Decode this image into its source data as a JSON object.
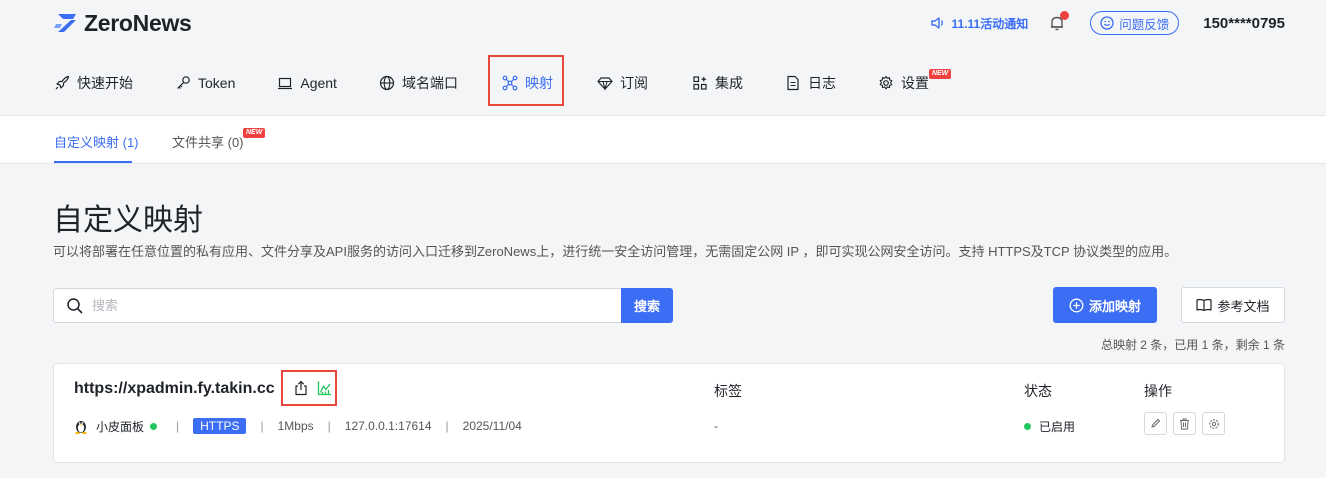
{
  "app": {
    "logo_text": "ZeroNews",
    "notice": "11.11活动通知",
    "feedback": "问题反馈",
    "user": "150****0795"
  },
  "nav": {
    "items": [
      {
        "label": "快速开始",
        "icon": "rocket-icon"
      },
      {
        "label": "Token",
        "icon": "key-icon"
      },
      {
        "label": "Agent",
        "icon": "laptop-icon"
      },
      {
        "label": "域名端口",
        "icon": "globe-icon"
      },
      {
        "label": "映射",
        "icon": "mapping-icon",
        "active": true
      },
      {
        "label": "订阅",
        "icon": "diamond-icon"
      },
      {
        "label": "集成",
        "icon": "grid-icon"
      },
      {
        "label": "日志",
        "icon": "file-icon"
      },
      {
        "label": "设置",
        "icon": "gear-icon",
        "badge": "NEW"
      }
    ]
  },
  "subtabs": [
    {
      "label": "自定义映射 (1)",
      "active": true
    },
    {
      "label": "文件共享 (0)",
      "badge": "NEW"
    }
  ],
  "page": {
    "title": "自定义映射",
    "description": "可以将部署在任意位置的私有应用、文件分享及API服务的访问入口迁移到ZeroNews上，进行统一安全访问管理，无需固定公网 IP ，即可实现公网安全访问。支持 HTTPS及TCP 协议类型的应用。"
  },
  "search": {
    "placeholder": "搜索",
    "value": "",
    "button": "搜索"
  },
  "actions": {
    "add": "添加映射",
    "docs": "参考文档"
  },
  "quota": "总映射 2 条，已用 1 条，剩余 1 条",
  "mapping": {
    "domain": "https://xpadmin.fy.takin.cc",
    "columns": {
      "tags": "标签",
      "status": "状态",
      "ops": "操作"
    },
    "device": "小皮面板",
    "protocol": "HTTPS",
    "bandwidth": "1Mbps",
    "address": "127.0.0.1:17614",
    "date": "2025/11/04",
    "tags": "-",
    "status": "已启用"
  },
  "colors": {
    "accent": "#3b6ef5",
    "highlight": "#e8473b",
    "online": "#22c55e"
  }
}
